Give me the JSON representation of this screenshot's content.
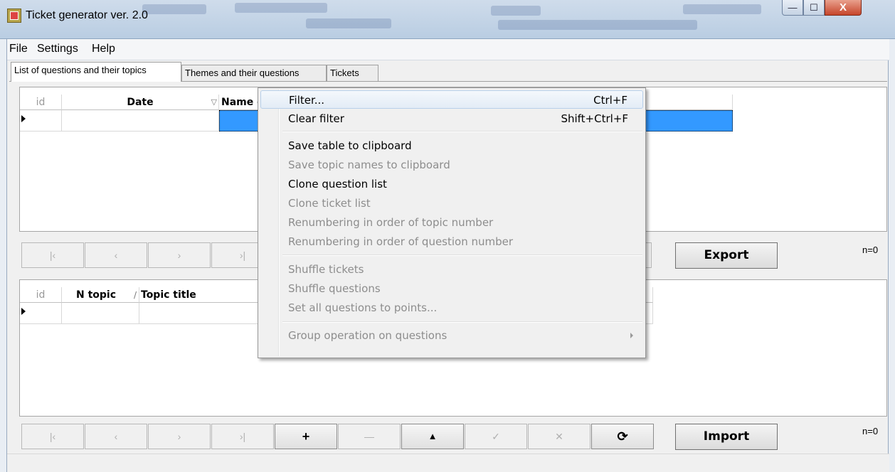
{
  "window": {
    "title": "Ticket generator ver. 2.0",
    "min_glyph": "—",
    "max_glyph": "☐",
    "close_glyph": "X"
  },
  "menu": [
    "File",
    "Settings",
    "Help"
  ],
  "tabs": [
    "List of questions and their topics",
    "Themes and their questions",
    "Tickets"
  ],
  "grid1": {
    "col_id": "id",
    "col_date": "Date",
    "col_name": "Name of the list of questions",
    "sort_glyph": "▽"
  },
  "grid2": {
    "col_id": "id",
    "col_ntopic": "N topic",
    "col_title": "Topic title",
    "sort_glyph": "/"
  },
  "nav_glyphs": {
    "first": "|‹",
    "prior": "‹",
    "next": "›",
    "last": "›|",
    "insert": "+",
    "delete": "—",
    "post": "▲",
    "edit": "✓",
    "cancel": "✕",
    "refresh": "⟳"
  },
  "export_label": "Export",
  "import_label": "Import",
  "count1": "n=0",
  "count2": "n=0",
  "context_menu": {
    "filter": {
      "label": "Filter...",
      "shortcut": "Ctrl+F"
    },
    "clear_filter": {
      "label": "Clear filter",
      "shortcut": "Shift+Ctrl+F"
    },
    "save_table": "Save table to clipboard",
    "save_topics": "Save topic names to clipboard",
    "clone_question": "Clone question list",
    "clone_ticket": "Clone ticket list",
    "renum_topic": "Renumbering in order of topic number",
    "renum_question": "Renumbering in order of question number",
    "shuffle_tickets": "Shuffle tickets",
    "shuffle_questions": "Shuffle questions",
    "set_points": "Set all questions to points...",
    "group_op": "Group operation on questions"
  },
  "colors": {
    "selection": "#3399ff",
    "title_bar": "#c4d5e8"
  }
}
